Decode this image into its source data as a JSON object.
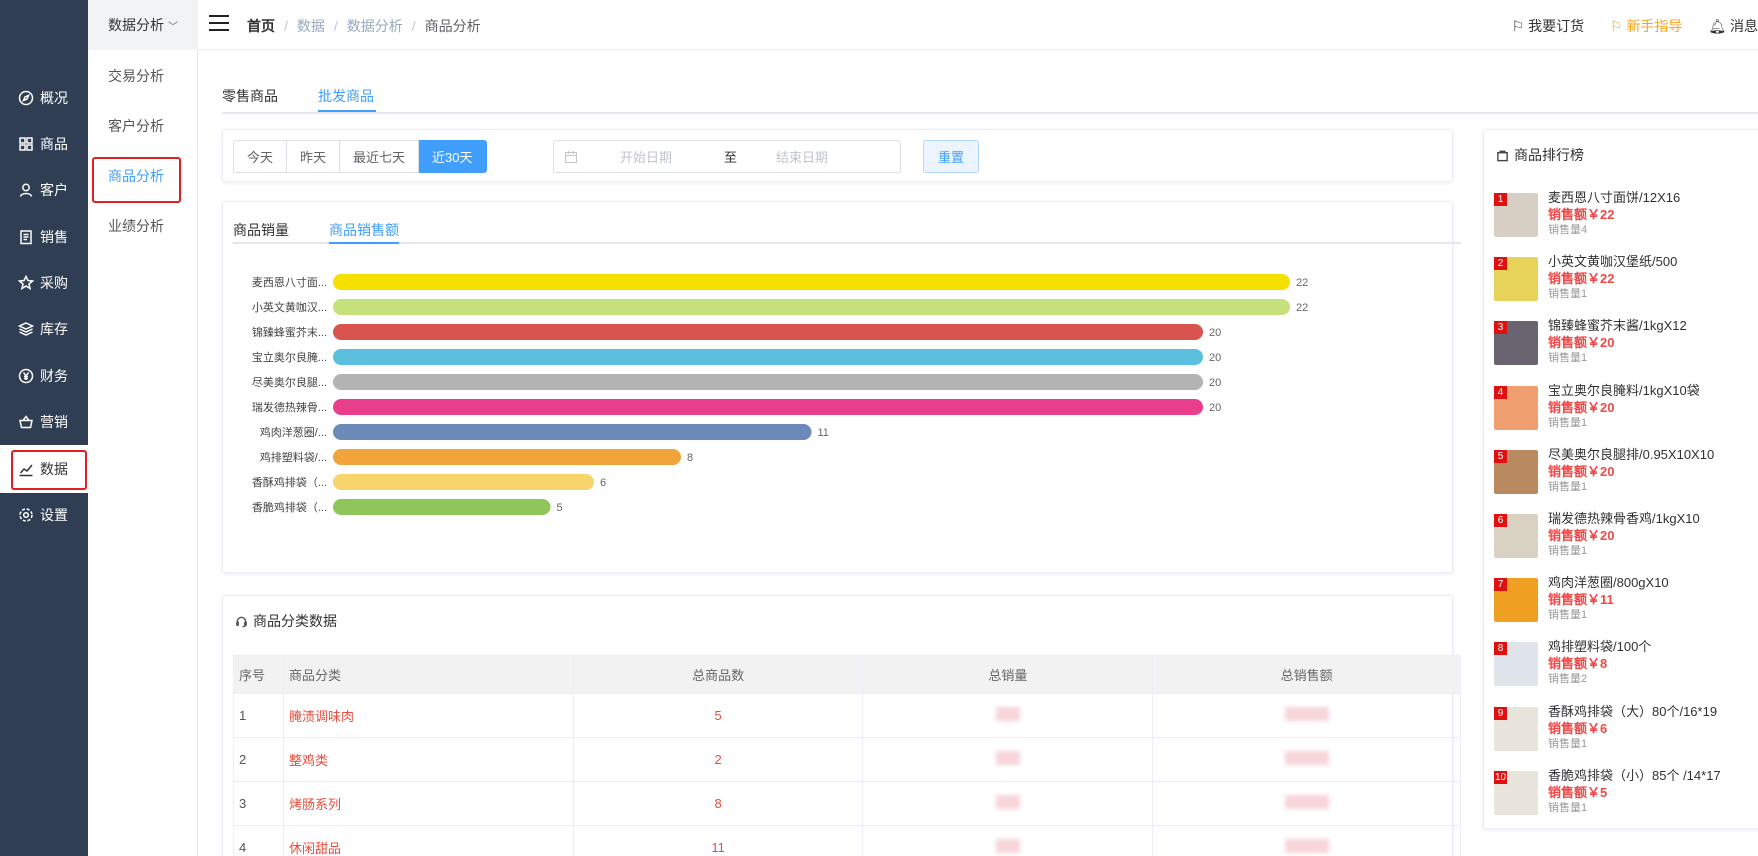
{
  "left_nav": {
    "items": [
      {
        "label": "概况",
        "icon": "compass-icon"
      },
      {
        "label": "商品",
        "icon": "grid-icon"
      },
      {
        "label": "客户",
        "icon": "user-icon"
      },
      {
        "label": "销售",
        "icon": "document-icon"
      },
      {
        "label": "采购",
        "icon": "purchase-icon"
      },
      {
        "label": "库存",
        "icon": "layers-icon"
      },
      {
        "label": "财务",
        "icon": "yen-icon"
      },
      {
        "label": "营销",
        "icon": "basket-icon"
      },
      {
        "label": "数据",
        "icon": "chart-icon"
      },
      {
        "label": "设置",
        "icon": "gear-icon"
      }
    ],
    "active": "数据"
  },
  "sub_menu": {
    "header": "数据分析",
    "items": [
      "交易分析",
      "客户分析",
      "商品分析",
      "业绩分析"
    ],
    "active": "商品分析"
  },
  "breadcrumb": [
    "首页",
    "数据",
    "数据分析",
    "商品分析"
  ],
  "top_right": {
    "order": "我要订货",
    "guide": "新手指导",
    "message": "消息"
  },
  "main_tabs": [
    "零售商品",
    "批发商品"
  ],
  "main_tab_active": "批发商品",
  "filter": {
    "ranges": [
      "今天",
      "昨天",
      "最近七天",
      "近30天"
    ],
    "active_range": "近30天",
    "start_placeholder": "开始日期",
    "separator": "至",
    "end_placeholder": "结束日期",
    "reset": "重置"
  },
  "chart_tabs": [
    "商品销量",
    "商品销售额"
  ],
  "chart_tab_active": "商品销售额",
  "chart_data": {
    "type": "bar",
    "orientation": "horizontal",
    "categories": [
      "麦西恩八寸面...",
      "小英文黄咖汉...",
      "锦臻蜂蜜芥末...",
      "宝立奥尔良腌...",
      "尽美奥尔良腿...",
      "瑞发德热辣骨...",
      "鸡肉洋葱圈/...",
      "鸡排塑料袋/...",
      "香酥鸡排袋（...",
      "香脆鸡排袋（..."
    ],
    "values": [
      22,
      22,
      20,
      20,
      20,
      20,
      11,
      8,
      6,
      5
    ],
    "colors": [
      "#f5e000",
      "#c6e07a",
      "#d9534f",
      "#5bc0de",
      "#b3b3b3",
      "#e83e8c",
      "#6c8ab8",
      "#f0a43a",
      "#f7d56a",
      "#8fc65c"
    ],
    "xlim": [
      0,
      22
    ]
  },
  "category_table": {
    "title": "商品分类数据",
    "columns": [
      "序号",
      "商品分类",
      "总商品数",
      "总销量",
      "总销售额"
    ],
    "rows": [
      {
        "idx": "1",
        "name": "腌渍调味肉",
        "count": "5"
      },
      {
        "idx": "2",
        "name": "整鸡类",
        "count": "2"
      },
      {
        "idx": "3",
        "name": "烤肠系列",
        "count": "8"
      },
      {
        "idx": "4",
        "name": "休闲甜品",
        "count": "11"
      }
    ]
  },
  "ranking": {
    "title": "商品排行榜",
    "amount_label": "销售额￥",
    "qty_label": "销售量",
    "items": [
      {
        "rank": "1",
        "name": "麦西恩八寸面饼/12X16",
        "amount": "22",
        "qty": "4",
        "thumb": "#d8cfc4"
      },
      {
        "rank": "2",
        "name": "小英文黄咖汉堡纸/500",
        "amount": "22",
        "qty": "1",
        "thumb": "#e8d35a"
      },
      {
        "rank": "3",
        "name": "锦臻蜂蜜芥末酱/1kgX12",
        "amount": "20",
        "qty": "1",
        "thumb": "#6a6470"
      },
      {
        "rank": "4",
        "name": "宝立奥尔良腌料/1kgX10袋",
        "amount": "20",
        "qty": "1",
        "thumb": "#f0a070"
      },
      {
        "rank": "5",
        "name": "尽美奥尔良腿排/0.95X10X10",
        "amount": "20",
        "qty": "1",
        "thumb": "#b98a60"
      },
      {
        "rank": "6",
        "name": "瑞发德热辣骨香鸡/1kgX10",
        "amount": "20",
        "qty": "1",
        "thumb": "#d9d2c2"
      },
      {
        "rank": "7",
        "name": "鸡肉洋葱圈/800gX10",
        "amount": "11",
        "qty": "1",
        "thumb": "#f0a020"
      },
      {
        "rank": "8",
        "name": "鸡排塑料袋/100个",
        "amount": "8",
        "qty": "2",
        "thumb": "#dfe3ea"
      },
      {
        "rank": "9",
        "name": "香酥鸡排袋（大）80个/16*19",
        "amount": "6",
        "qty": "1",
        "thumb": "#e9e4dc"
      },
      {
        "rank": "10",
        "name": "香脆鸡排袋（小）85个 /14*17",
        "amount": "5",
        "qty": "1",
        "thumb": "#e9e4dc"
      }
    ]
  }
}
